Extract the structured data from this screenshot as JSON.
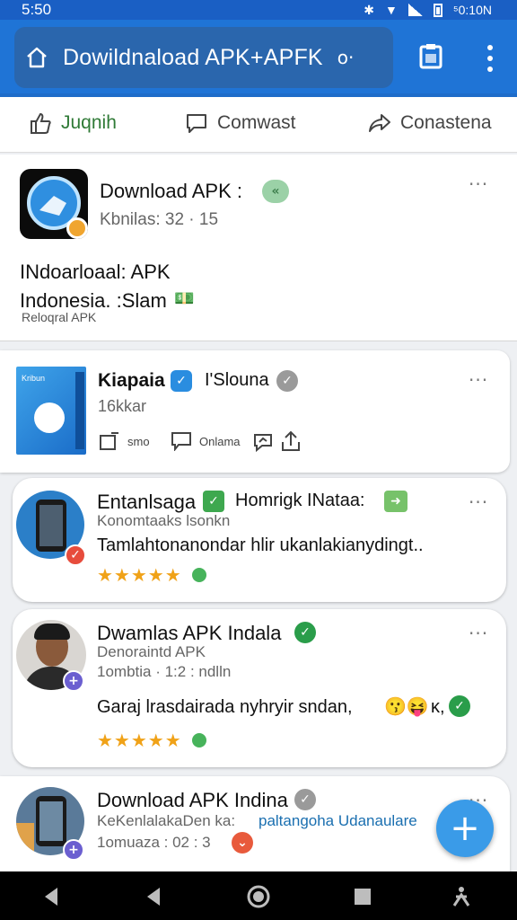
{
  "status_bar": {
    "time": "5:50",
    "right_text": "⁵0:10N"
  },
  "app_bar": {
    "url": "Dowildnaload APK+APFK",
    "key_glyph": "o·"
  },
  "actions": [
    {
      "label": "Juqnih"
    },
    {
      "label": "Comwast"
    },
    {
      "label": "Conastena"
    }
  ],
  "colors": {
    "accent": "#1f74d6",
    "verified": "#2a9d4a",
    "fab": "#3a9be8",
    "star": "#f0a218"
  },
  "post1": {
    "title": "Download APK :",
    "subtitle": "Kbnilas: 32 · 15",
    "body_line1": "INdoarloaal: APK",
    "body_line2": "Indonesia. :Slam",
    "body_emoji": "💵",
    "small": "Reloqral APK",
    "more": "···"
  },
  "post2": {
    "title": "Kiapaia",
    "title2": "I'Slouna",
    "subtitle": "16kkar",
    "actions": [
      "smo",
      "Onlama"
    ],
    "more": "···",
    "thumb_text": "Kribun"
  },
  "post3": {
    "title": "Entanlsaga",
    "title2": "Homrigk INataa:",
    "subtitle": "Konomtaaks lsonkn",
    "body": "Tamlahtonanondar hlir ukanlakianydingt..",
    "stars": "★★★★★",
    "more": "···"
  },
  "post4": {
    "title": "Dwamlas APK Indala",
    "subtitle": "Denoraintd APK",
    "meta": "1ombtia · 1:2 : ndlln",
    "body": "Garaj lrasdairada nyhryir sndan,",
    "emojis": "😗😝",
    "trail": "ĸ,",
    "stars": "★★★★★",
    "more": "···"
  },
  "post5": {
    "title": "Download APK Indina",
    "subtitle": "KeKenlalakaDen ka:",
    "subtitle_link": "paltangoha Udanaulare",
    "meta": "1omuaza : 02 : 3",
    "more": "···"
  },
  "fab_label": "+"
}
